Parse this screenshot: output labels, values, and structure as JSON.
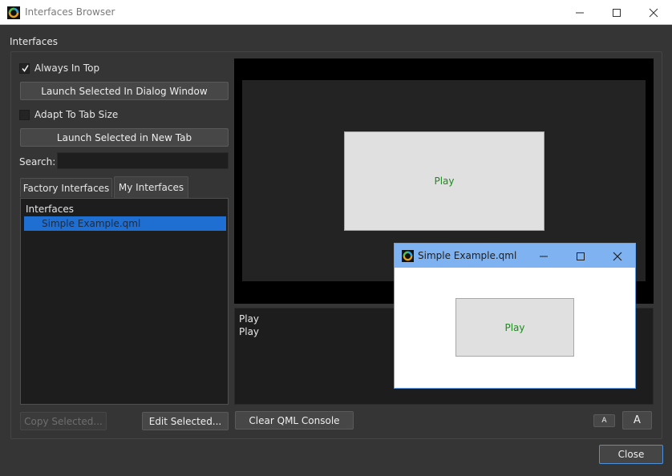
{
  "window": {
    "title": "Interfaces Browser",
    "controls": [
      "minimize-icon",
      "maximize-icon",
      "close-icon"
    ]
  },
  "section_label": "Interfaces",
  "left_panel": {
    "always_on_top": {
      "label": "Always In Top",
      "checked": true
    },
    "launch_dialog_label": "Launch Selected In Dialog Window",
    "adapt_tab_size": {
      "label": "Adapt To Tab Size",
      "checked": false
    },
    "launch_new_tab_label": "Launch Selected in New Tab",
    "search": {
      "label": "Search:",
      "value": "",
      "placeholder": ""
    },
    "tabs": [
      {
        "label": "Factory Interfaces",
        "active": false
      },
      {
        "label": "My Interfaces",
        "active": true
      }
    ],
    "tree": {
      "header": "Interfaces",
      "items": [
        {
          "label": "Simple Example.qml",
          "selected": true
        }
      ]
    },
    "copy_selected_label": "Copy Selected...",
    "edit_selected_label": "Edit Selected..."
  },
  "preview": {
    "play_label": "Play"
  },
  "console": {
    "lines": [
      "Play",
      "Play"
    ],
    "clear_label": "Clear QML Console",
    "font_smaller_label": "A",
    "font_larger_label": "A"
  },
  "dialog": {
    "title": "Simple Example.qml",
    "play_label": "Play"
  },
  "footer": {
    "close_label": "Close"
  },
  "colors": {
    "accent": "#1f6fd2",
    "play_text": "#1b8c1b",
    "dialog_titlebar": "#7fb2f0"
  }
}
